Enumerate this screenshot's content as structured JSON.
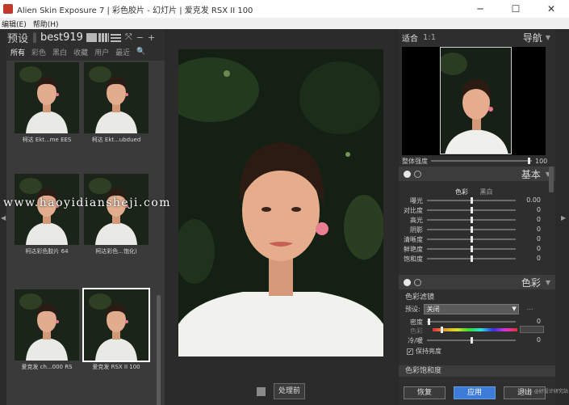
{
  "window": {
    "title": "Alien Skin Exposure 7 | 彩色胶片 - 幻灯片 | 爱克发 RSX II 100",
    "minimize_glyph": "─",
    "maximize_glyph": "☐",
    "close_glyph": "✕"
  },
  "menu": {
    "items": [
      "编辑(E)",
      "帮助(H)"
    ]
  },
  "left_panel": {
    "title": "预设",
    "separator": "‖",
    "collection": "best919",
    "minus_glyph": "−",
    "plus_glyph": "+",
    "tabs": [
      "所有",
      "彩色",
      "黑白",
      "收藏",
      "用户",
      "最近"
    ],
    "active_tab": "所有",
    "search_icon": "🔍",
    "presets": [
      {
        "label": "柯达 Ekt...me EES"
      },
      {
        "label": "柯达 Ekt...ubdued"
      },
      {
        "label": "柯达彩色胶片 64"
      },
      {
        "label": "柯达彩色...饱化)"
      },
      {
        "label": "爱克发 ch...000 RS"
      },
      {
        "label": "爱克发 RSX II 100",
        "selected": true
      }
    ]
  },
  "center": {
    "before_button": "处理前"
  },
  "edge_arrows": {
    "left": "◀",
    "right": "▶"
  },
  "navigator": {
    "fit_label": "适合",
    "ratio_label": "1:1",
    "title": "导航",
    "caret": "▼"
  },
  "opacity": {
    "label": "整体强度",
    "value": "100",
    "fraction": 0.97
  },
  "basic": {
    "title": "基本",
    "tabs": [
      "色彩",
      "黑白"
    ],
    "active_tab": "色彩",
    "rows": [
      {
        "label": "曝光",
        "value": "0.00",
        "fraction": 0.5
      },
      {
        "label": "对比度",
        "value": "0",
        "fraction": 0.5
      },
      {
        "label": "高光",
        "value": "0",
        "fraction": 0.5
      },
      {
        "label": "阴影",
        "value": "0",
        "fraction": 0.5
      },
      {
        "label": "清晰度",
        "value": "0",
        "fraction": 0.5
      },
      {
        "label": "鲜艳度",
        "value": "0",
        "fraction": 0.5
      },
      {
        "label": "饱和度",
        "value": "0",
        "fraction": 0.5
      }
    ]
  },
  "color": {
    "title": "色彩",
    "filter_title": "色彩滤镜",
    "preset_label": "预设:",
    "preset_value": "关闭",
    "rows": [
      {
        "label": "密度",
        "value": "0",
        "fraction": 0.02
      },
      {
        "label": "色彩",
        "value": "",
        "fraction": 0.1
      },
      {
        "label": "冷/暖",
        "value": "0",
        "fraction": 0.5
      }
    ],
    "checkbox_label": "保持亮度",
    "checkbox_checked": true,
    "checkbox_mark": "✓",
    "saturation_title": "色彩饱和度"
  },
  "actions": {
    "reset": "恢复",
    "apply": "应用",
    "cancel": "退出"
  },
  "watermark": "www.haoyidiansheji.com",
  "corner_mark": "头条 @好设计研究站",
  "colors": {
    "accent": "#3d7bd9",
    "panel": "#2e2e2e",
    "thumb_bg": "#3a3a3a"
  }
}
